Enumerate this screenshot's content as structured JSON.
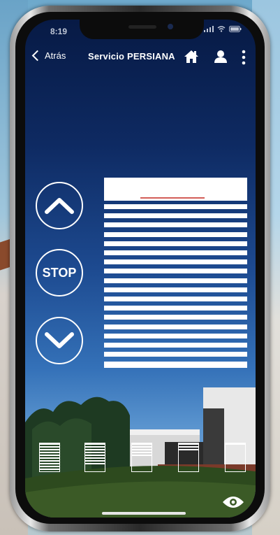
{
  "status": {
    "time": "8:19",
    "icons": "signal wifi battery"
  },
  "header": {
    "back_label": "Atrás",
    "title": "Servicio PERSIANA"
  },
  "icons": {
    "home": "home-icon",
    "user": "user-icon",
    "more": "more-vertical-icon",
    "eye": "eye-icon"
  },
  "controls": {
    "up": "chevron-up-icon",
    "stop_label": "STOP",
    "down": "chevron-down-icon"
  },
  "blind": {
    "open_fraction": 0.0
  },
  "presets": [
    {
      "name": "preset-closed",
      "level": 1.0
    },
    {
      "name": "preset-75",
      "level": 0.75
    },
    {
      "name": "preset-50",
      "level": 0.5
    },
    {
      "name": "preset-25",
      "level": 0.25
    },
    {
      "name": "preset-open",
      "level": 0.0
    }
  ],
  "colors": {
    "screen_top": "#071a45",
    "accent_red": "#c8352d",
    "foreground": "#ffffff"
  }
}
